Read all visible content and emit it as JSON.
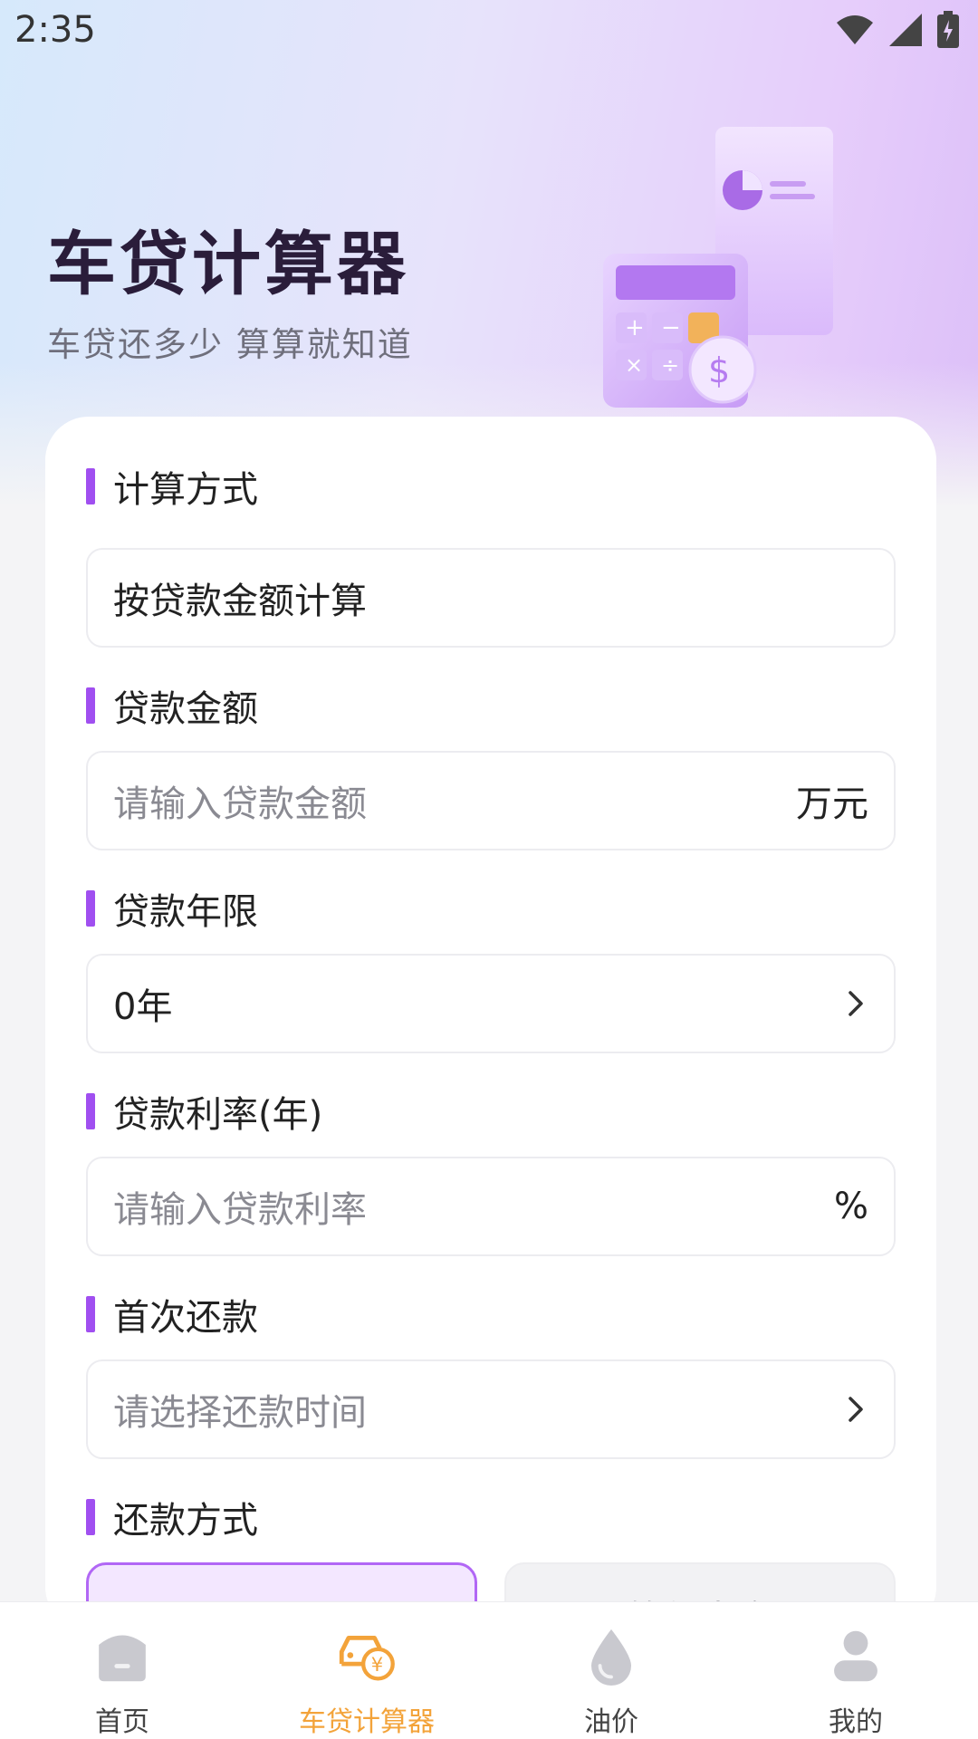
{
  "status_bar": {
    "time": "2:35"
  },
  "header": {
    "title": "车贷计算器",
    "subtitle": "车贷还多少 算算就知道"
  },
  "form": {
    "calc_method": {
      "label": "计算方式",
      "value": "按贷款金额计算"
    },
    "loan_amount": {
      "label": "贷款金额",
      "placeholder": "请输入贷款金额",
      "unit": "万元"
    },
    "loan_term": {
      "label": "贷款年限",
      "value": "0年"
    },
    "loan_rate": {
      "label": "贷款利率(年)",
      "placeholder": "请输入贷款利率",
      "unit": "%"
    },
    "first_payment": {
      "label": "首次还款",
      "placeholder": "请选择还款时间"
    },
    "repay_method": {
      "label": "还款方式",
      "options": [
        "等额本息",
        "等额本金"
      ],
      "selected": "等额本息"
    }
  },
  "bottom_nav": {
    "items": [
      {
        "label": "首页",
        "icon": "home-icon",
        "active": false
      },
      {
        "label": "车贷计算器",
        "icon": "car-loan-icon",
        "active": true
      },
      {
        "label": "油价",
        "icon": "oil-drop-icon",
        "active": false
      },
      {
        "label": "我的",
        "icon": "user-icon",
        "active": false
      }
    ]
  },
  "colors": {
    "accent": "#a04ff0",
    "nav_active": "#f3a33a"
  }
}
